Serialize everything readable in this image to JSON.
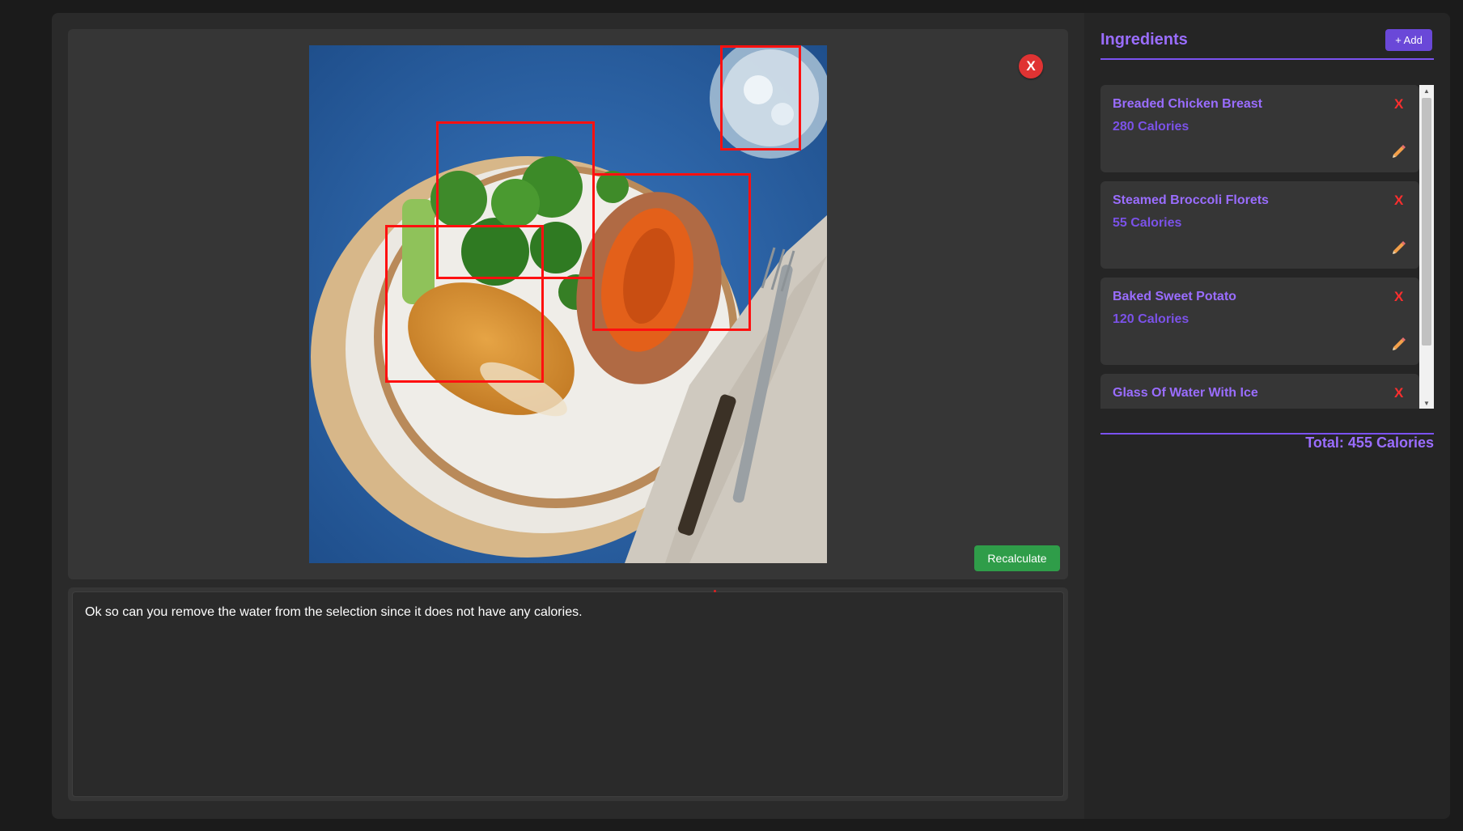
{
  "image_panel": {
    "close_label": "X",
    "recalculate_label": "Recalculate"
  },
  "prompt": {
    "value": "Ok so can you remove the water from the selection since it does not have any calories."
  },
  "ingredients": {
    "title": "Ingredients",
    "add_label": "+ Add",
    "delete_label": "X",
    "items": [
      {
        "name": "Breaded Chicken Breast",
        "calories": "280 Calories"
      },
      {
        "name": "Steamed Broccoli Florets",
        "calories": "55 Calories"
      },
      {
        "name": "Baked Sweet Potato",
        "calories": "120 Calories"
      },
      {
        "name": "Glass Of Water With Ice",
        "calories": ""
      }
    ],
    "total": "Total: 455 Calories"
  },
  "colors": {
    "accent": "#9a6dff",
    "add_button": "#6a48d8",
    "delete": "#ff2e2e",
    "recalculate": "#2f9d49",
    "detection_box": "#ff1010"
  },
  "icons": {
    "edit": "pencil-icon",
    "close": "close-icon"
  }
}
